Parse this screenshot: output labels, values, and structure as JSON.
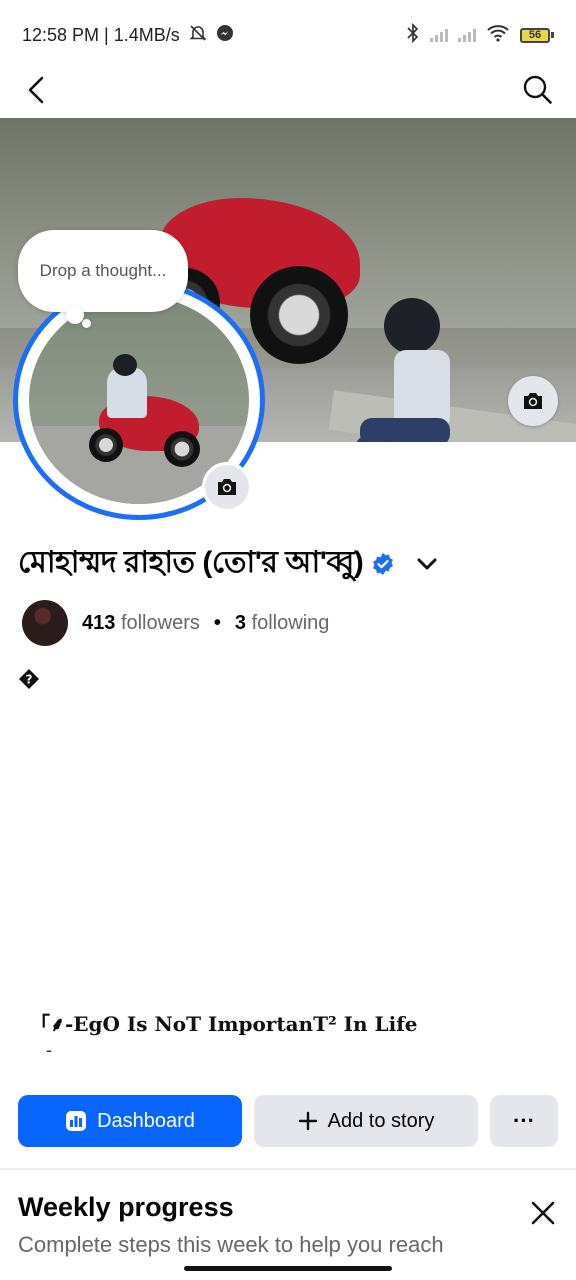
{
  "status_bar": {
    "time_info": "12:58 PM | 1.4MB/s",
    "battery": "56"
  },
  "thought_bubble": {
    "placeholder": "Drop a thought..."
  },
  "profile": {
    "name": "মোহাম্মদ রাহাত (তো'র আ'ব্বু)",
    "followers_count": "413",
    "followers_label": "followers",
    "following_count": "3",
    "following_label": "following",
    "separator": "•",
    "bio_glyph": "?",
    "tagline": "「⸙-EgO Is NoT ImportanT² In Life",
    "tagline_dash": "-"
  },
  "actions": {
    "dashboard_label": "Dashboard",
    "add_story_label": "Add to story",
    "more_label": "···"
  },
  "weekly": {
    "title": "Weekly progress",
    "subtitle": "Complete steps this week to help you reach"
  },
  "colors": {
    "accent": "#0866ff",
    "verified": "#1b6ff5"
  }
}
